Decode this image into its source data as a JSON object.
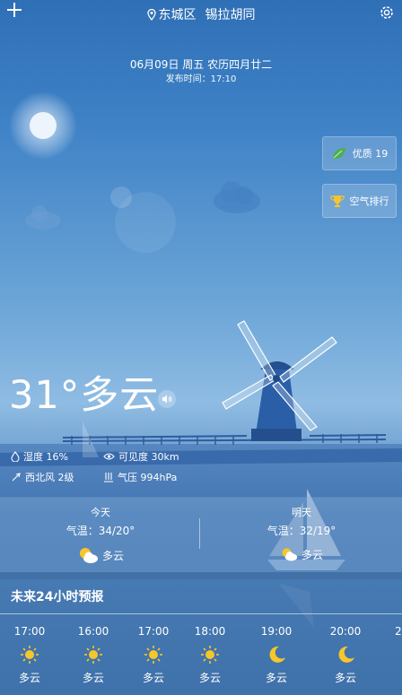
{
  "header": {
    "district": "东城区",
    "street": "锡拉胡同",
    "date_line": "06月09日 周五 农历四月廿二",
    "publish_time": "发布时间：17:10"
  },
  "side_buttons": {
    "air_quality": "优质 19",
    "air_rank": "空气排行"
  },
  "current": {
    "temp_condition": "31°多云",
    "humidity": "湿度 16%",
    "visibility": "可见度 30km",
    "wind": "西北风 2级",
    "pressure": "气压 994hPa"
  },
  "days": [
    {
      "label": "今天",
      "temp": "气温：34/20°",
      "condition": "多云"
    },
    {
      "label": "明天",
      "temp": "气温：32/19°",
      "condition": "多云"
    }
  ],
  "forecast": {
    "title": "未来24小时预报",
    "hours": [
      {
        "time": "17:00",
        "condition": "多云",
        "icon": "sun-icon"
      },
      {
        "time": "16:00",
        "condition": "多云",
        "icon": "sun-icon"
      },
      {
        "time": "17:00",
        "condition": "多云",
        "icon": "sun-icon"
      },
      {
        "time": "18:00",
        "condition": "多云",
        "icon": "sun-icon"
      },
      {
        "time": "19:00",
        "condition": "多云",
        "icon": "moon-icon"
      },
      {
        "time": "20:00",
        "condition": "多云",
        "icon": "moon-icon"
      }
    ]
  },
  "colors": {
    "sky_top": "#2f6fb6",
    "sun": "#f6c62a",
    "leaf": "#4caf50"
  }
}
